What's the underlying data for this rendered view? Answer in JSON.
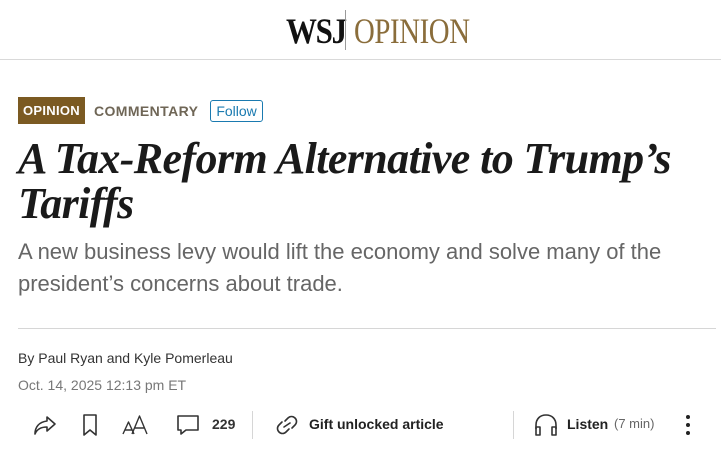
{
  "masthead": {
    "logo_primary": "WSJ",
    "logo_section": "OPINION",
    "section_color": "#8a6d3b"
  },
  "article": {
    "flag": "OPINION",
    "flag_color": "#7b5a22",
    "category": "COMMENTARY",
    "follow_label": "Follow",
    "headline": "A Tax-Reform Alternative to Trump’s Tariffs",
    "dek": "A new business levy would lift the economy and solve many of the president’s concerns about trade.",
    "byline_prefix": "By",
    "authors": [
      "Paul Ryan",
      "Kyle Pomerleau"
    ],
    "author_joiner": "and",
    "date": "Oct. 14, 2025 12:13 pm ET"
  },
  "toolbar": {
    "share_icon": "share-icon",
    "save_icon": "bookmark-icon",
    "text_size_icon": "text-size-icon",
    "comment_icon": "comment-icon",
    "comment_count": "229",
    "gift_icon": "link-icon",
    "gift_label": "Gift unlocked article",
    "listen_icon": "headphones-icon",
    "listen_label": "Listen",
    "listen_duration": "(7 min)",
    "more_icon": "more-vertical-icon"
  }
}
